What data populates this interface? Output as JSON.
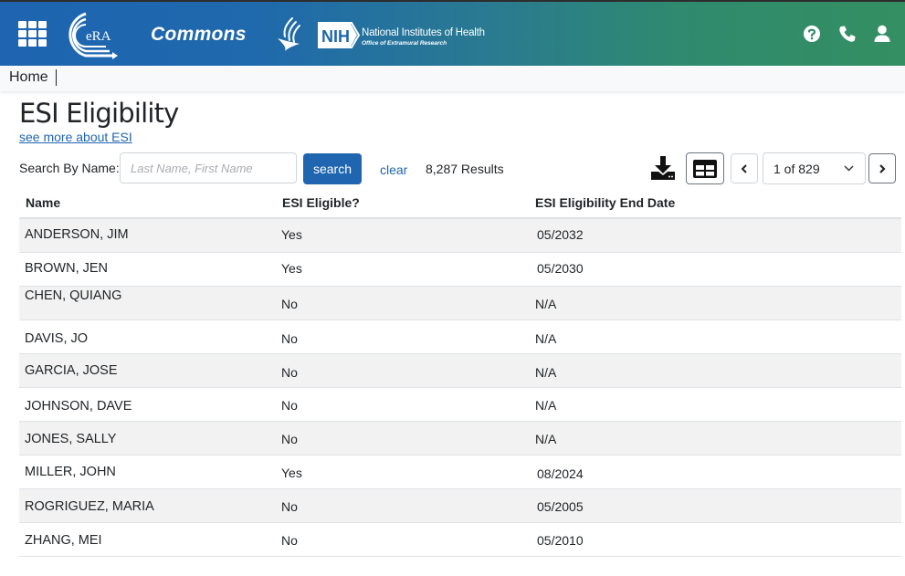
{
  "header": {
    "app_name": "Commons",
    "era_logo_text": "eRA",
    "nih_badge": "NIH",
    "nih_line1": "National Institutes of Health",
    "nih_line2": "Office of Extramural Research",
    "icons": [
      "apps-grid-icon",
      "help-icon",
      "phone-icon",
      "user-icon"
    ]
  },
  "breadcrumb": {
    "home": "Home"
  },
  "page": {
    "title": "ESI Eligibility",
    "see_more_link": "see more about ESI"
  },
  "search": {
    "label": "Search By Name:",
    "value": "",
    "placeholder": "Last Name, First Name",
    "search_button": "search",
    "clear_link": "clear",
    "results": "8,287 Results"
  },
  "pagination": {
    "current": "1 of 829",
    "prev_icon": "chevron-left-icon",
    "next_icon": "chevron-right-icon"
  },
  "table": {
    "columns": [
      "Name",
      "ESI Eligible?",
      "ESI Eligibility End Date"
    ],
    "rows": [
      {
        "name": "ANDERSON, JIM",
        "eligible": "Yes",
        "end_date": "05/2032"
      },
      {
        "name": "BROWN, JEN",
        "eligible": "Yes",
        "end_date": "05/2030"
      },
      {
        "name": "CHEN, QUIANG",
        "eligible": "No",
        "end_date": "N/A"
      },
      {
        "name": "DAVIS, JO",
        "eligible": "No",
        "end_date": "N/A"
      },
      {
        "name": "GARCIA, JOSE",
        "eligible": "No",
        "end_date": "N/A"
      },
      {
        "name": "JOHNSON, DAVE",
        "eligible": "No",
        "end_date": "N/A"
      },
      {
        "name": "JONES, SALLY",
        "eligible": "No",
        "end_date": "N/A"
      },
      {
        "name": "MILLER, JOHN",
        "eligible": "Yes",
        "end_date": "08/2024"
      },
      {
        "name": "ROGRIGUEZ, MARIA",
        "eligible": "No",
        "end_date": "05/2005"
      },
      {
        "name": "ZHANG, MEI",
        "eligible": "No",
        "end_date": "05/2010"
      }
    ]
  },
  "colors": {
    "brand_blue": "#1f65b0",
    "header_green": "#348f62",
    "row_stripe": "#f2f2f2"
  }
}
